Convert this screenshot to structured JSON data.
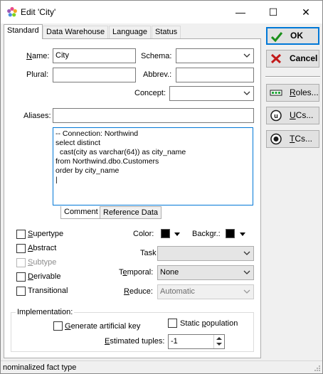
{
  "window": {
    "title": "Edit 'City'",
    "controls": {
      "minimize": "—",
      "maximize": "☐",
      "close": "✕"
    }
  },
  "tabs": [
    {
      "label": "Standard",
      "active": true
    },
    {
      "label": "Data Warehouse",
      "active": false
    },
    {
      "label": "Language",
      "active": false
    },
    {
      "label": "Status",
      "active": false
    }
  ],
  "form": {
    "name_label": "Name:",
    "name_value": "City",
    "schema_label": "Schema:",
    "schema_value": "",
    "plural_label": "Plural:",
    "plural_value": "",
    "abbrev_label": "Abbrev.:",
    "abbrev_value": "",
    "concept_label": "Concept:",
    "concept_value": "",
    "aliases_label": "Aliases:",
    "aliases_value": "",
    "sql_text": "-- Connection: Northwind\nselect distinct\n  cast(city as varchar(64)) as city_name\nfrom Northwind.dbo.Customers\norder by city_name\n|"
  },
  "subtabs": [
    {
      "label": "Comment",
      "active": true
    },
    {
      "label": "Reference Data",
      "active": false
    }
  ],
  "options": {
    "supertype": "Supertype",
    "abstract": "Abstract",
    "subtype": "Subtype",
    "derivable": "Derivable",
    "transitional": "Transitional",
    "color_label": "Color:",
    "backgr_label": "Backgr.:",
    "color_value": "#000000",
    "backgr_value": "#000000",
    "task_label": "Task",
    "task_value": "",
    "temporal_label": "Temporal:",
    "temporal_value": "None",
    "reduce_label": "Reduce:",
    "reduce_value": "Automatic"
  },
  "implementation": {
    "group_label": "Implementation:",
    "generate_key": "Generate artificial key",
    "static_population": "Static population",
    "estimated_label": "Estimated tuples:",
    "estimated_value": "-1"
  },
  "buttons": {
    "ok": "OK",
    "cancel": "Cancel",
    "roles": "Roles...",
    "ucs": "UCs...",
    "tcs": "TCs..."
  },
  "colors": {
    "accent": "#0078d7",
    "ok_check": "#1a8f1a",
    "cancel_x": "#c21a1a"
  },
  "status_text": "nominalized fact type"
}
